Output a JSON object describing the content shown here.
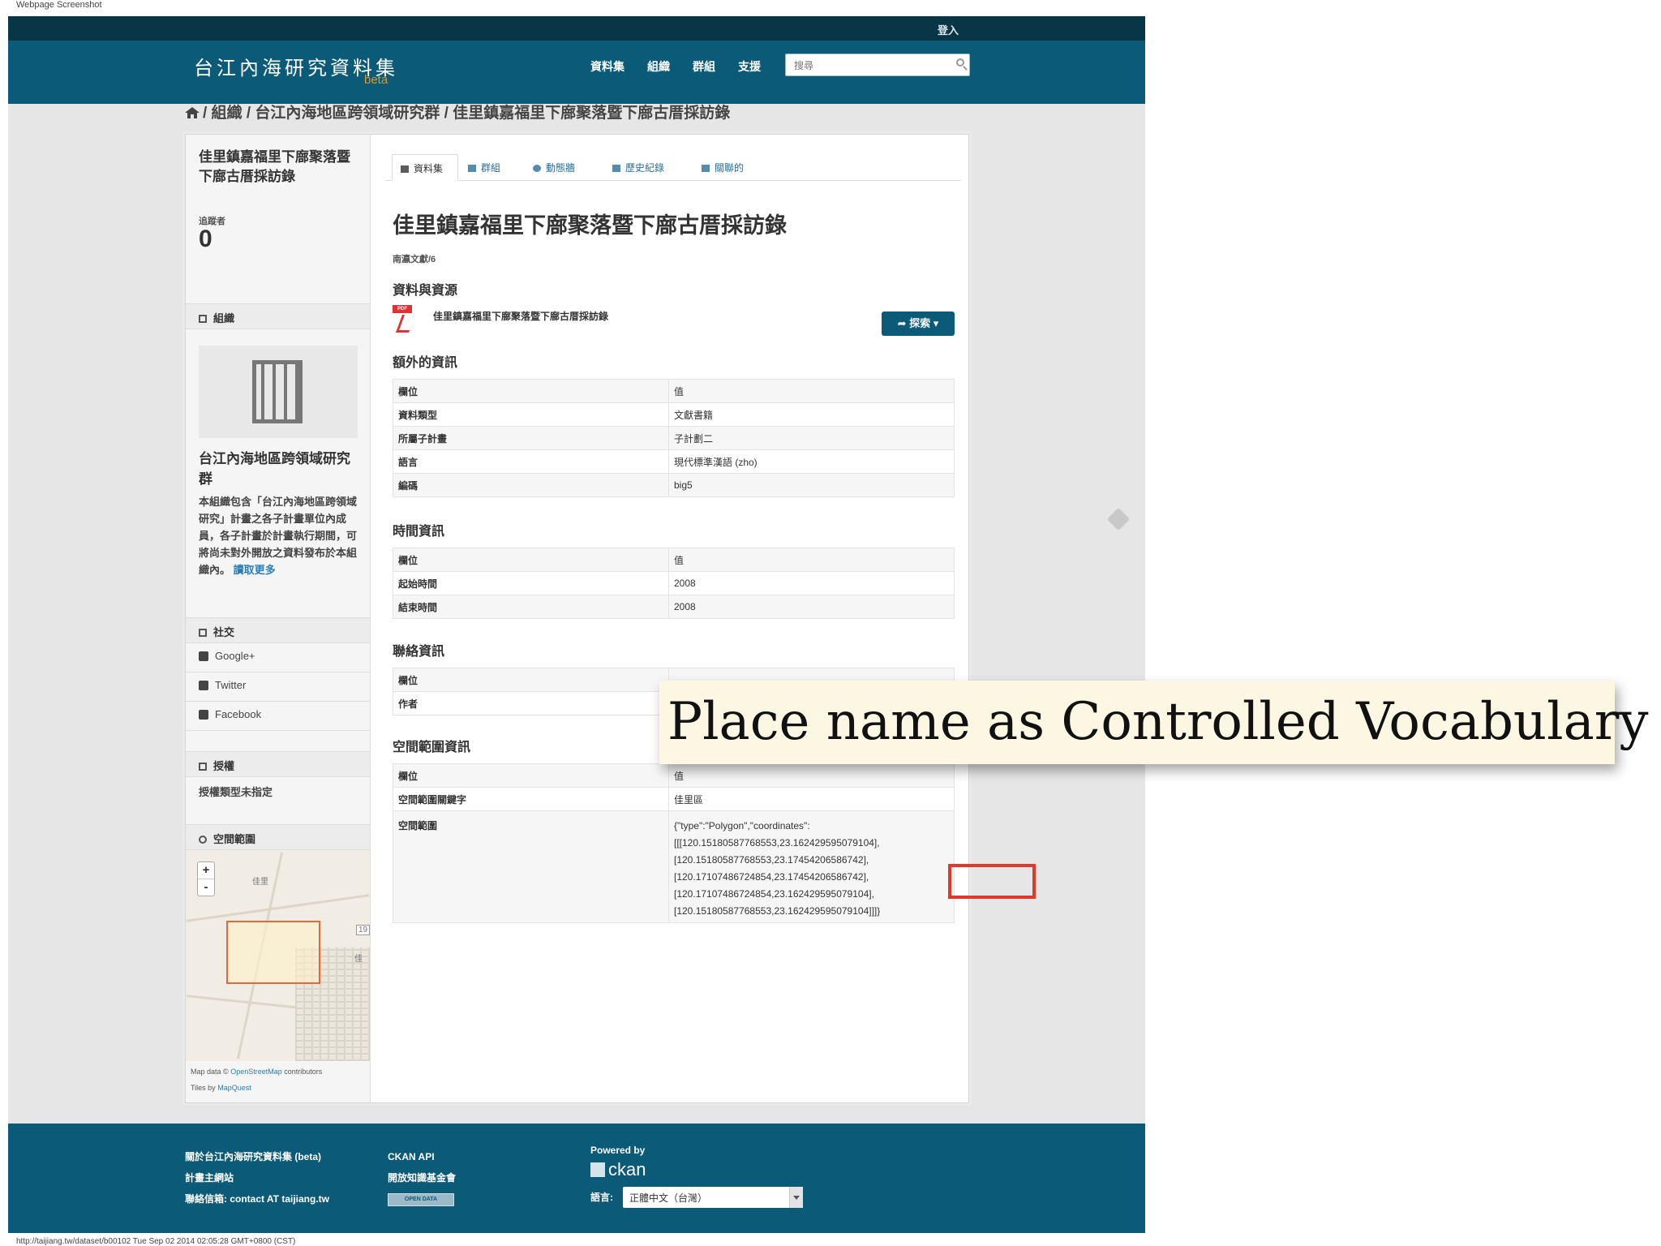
{
  "capture_label": "Webpage Screenshot",
  "site": {
    "login": "登入",
    "brand": "台江內海研究資料集",
    "beta": "beta",
    "nav": [
      "資料集",
      "組織",
      "群組",
      "支援"
    ],
    "search_placeholder": "搜尋"
  },
  "breadcrumb": "/ 組織 / 台江內海地區跨領域研究群 / 佳里鎮嘉福里下廍聚落暨下廍古厝採訪錄",
  "sidebar": {
    "title": "佳里鎮嘉福里下廍聚落暨下廍古厝採訪錄",
    "followers_label": "追蹤者",
    "followers_count": "0",
    "org_heading": "組織",
    "org_name": "台江內海地區跨領域研究群",
    "org_desc": "本組織包含「台江內海地區跨領域研究」計畫之各子計畫單位內成員，各子計畫於計畫執行期間，可將尚未對外開放之資料發布於本組織內。",
    "org_more": "讀取更多",
    "social_heading": "社交",
    "social": [
      "Google+",
      "Twitter",
      "Facebook"
    ],
    "license_heading": "授權",
    "license_text": "授權類型未指定",
    "spatial_heading": "空間範圍",
    "map_labels": [
      "佳里",
      "19",
      "佳"
    ],
    "map_attr_prefix": "Map data ©",
    "map_attr_link": "OpenStreetMap",
    "map_attr_suffix": "contributors",
    "tiles_prefix": "Tiles by",
    "tiles_link": "MapQuest"
  },
  "tabs": [
    "資料集",
    "群組",
    "動態牆",
    "歷史紀錄",
    "關聯的"
  ],
  "dataset": {
    "title": "佳里鎮嘉福里下廍聚落暨下廍古厝採訪錄",
    "catalog": "南瀛文獻/6",
    "resources_heading": "資料與資源",
    "resource_name": "佳里鎮嘉福里下廍聚落暨下廍古厝採訪錄",
    "explore_button": "探索",
    "extra_heading": "額外的資訊",
    "extra_rows": [
      [
        "欄位",
        "值"
      ],
      [
        "資料類型",
        "文獻書籍"
      ],
      [
        "所屬子計畫",
        "子計劃二"
      ],
      [
        "語言",
        "現代標準漢語 (zho)"
      ],
      [
        "編碼",
        "big5"
      ]
    ],
    "time_heading": "時間資訊",
    "time_rows": [
      [
        "欄位",
        "值"
      ],
      [
        "起始時間",
        "2008"
      ],
      [
        "結束時間",
        "2008"
      ]
    ],
    "contact_heading": "聯絡資訊",
    "contact_rows": [
      [
        "欄位",
        ""
      ],
      [
        "作者",
        ""
      ]
    ],
    "spatial_heading": "空間範圍資訊",
    "spatial_rows": [
      [
        "欄位",
        "值"
      ],
      [
        "空間範圍關鍵字",
        "佳里區"
      ]
    ],
    "spatial_extent_label": "空間範圍",
    "spatial_extent_lines": [
      "{\"type\":\"Polygon\",\"coordinates\":",
      "[[[120.15180587768553,23.162429595079104],",
      "[120.15180587768553,23.17454206586742],",
      "[120.17107486724854,23.17454206586742],",
      "[120.17107486724854,23.162429595079104],",
      "[120.15180587768553,23.162429595079104]]]}"
    ]
  },
  "footer": {
    "col1": [
      "關於台江內海研究資料集 (beta)",
      "計畫主網站",
      "聯絡信箱: contact AT taijiang.tw"
    ],
    "col2": [
      "CKAN API",
      "開放知識基金會"
    ],
    "open_data_badge": "OPEN DATA",
    "powered_by": "Powered by",
    "ckan": "ckan",
    "lang_label": "語言:",
    "lang_value": "正體中文（台灣）"
  },
  "status_bar": "http://taijiang.tw/dataset/b00102 Tue Sep 02 2014 02:05:28 GMT+0800 (CST)",
  "callout": "Place name as Controlled Vocabulary",
  "colors": {
    "masthead": "#0b5a77",
    "topbar": "#083647",
    "callout_bg": "#fbf7e2",
    "highlight": "#e0382b"
  }
}
